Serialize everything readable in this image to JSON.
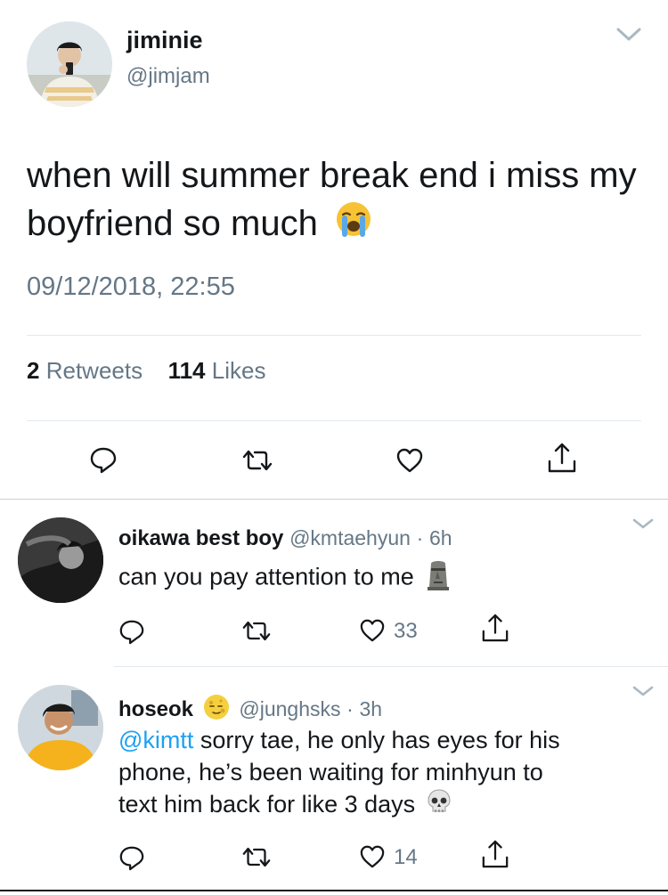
{
  "main_tweet": {
    "display_name": "jiminie",
    "handle": "@jimjam",
    "text": "when will summer break end i miss my boyfriend so much",
    "text_emoji": "loudly-crying-face-emoji",
    "timestamp": "09/12/2018, 22:55",
    "retweets_count": "2",
    "retweets_label": "Retweets",
    "likes_count": "114",
    "likes_label": "Likes"
  },
  "replies": [
    {
      "display_name": "oikawa best boy",
      "handle": "@kmtaehyun",
      "separator": "·",
      "time": "6h",
      "text": "can you pay attention to me",
      "text_emoji": "moai-emoji",
      "likes_count": "33"
    },
    {
      "display_name": "hoseok",
      "name_emoji": "full-moon-face-emoji",
      "handle": "@junghsks",
      "separator": "·",
      "time": "3h",
      "mention": "@kimtt",
      "text_line1": " sorry tae, he only has eyes for his",
      "text_line2": "phone, he’s been waiting for minhyun to",
      "text_line3": "text him back for like 3 days",
      "text_emoji": "skull-emoji",
      "likes_count": "14"
    }
  ],
  "colors": {
    "text_primary": "#14171a",
    "text_secondary": "#657786",
    "link": "#1da1f2",
    "divider": "#e1e8ed"
  }
}
